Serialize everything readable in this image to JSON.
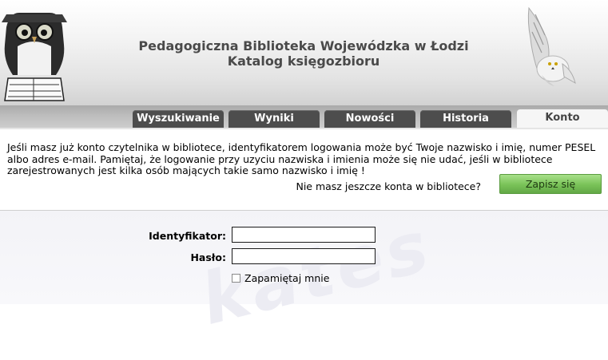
{
  "header": {
    "title_line1": "Pedagogiczna Biblioteka Wojewódzka w Łodzi",
    "title_line2": "Katalog księgozbioru"
  },
  "tabs": [
    {
      "label": "Wyszukiwanie",
      "active": false
    },
    {
      "label": "Wyniki",
      "active": false
    },
    {
      "label": "Nowości",
      "active": false
    },
    {
      "label": "Historia",
      "active": false
    },
    {
      "label": "Konto",
      "active": true
    }
  ],
  "info": {
    "text": "Jeśli masz już konto czytelnika w bibliotece, identyfikatorem logowania może być Twoje nazwisko i imię, numer PESEL albo adres e-mail. Pamiętaj, że logowanie przy uzyciu nazwiska i imienia może się nie udać, jeśli w bibliotece zarejestrowanych jest kilka osób mających takie samo nazwisko i imię !",
    "register_question": "Nie masz jeszcze konta w bibliotece?",
    "register_button": "Zapisz się"
  },
  "login": {
    "identifier_label": "Identyfikator:",
    "identifier_value": "",
    "password_label": "Hasło:",
    "password_value": "",
    "remember_label": "Zapamiętaj mnie",
    "remember_checked": false
  },
  "watermark": "kates",
  "colors": {
    "tab_bg": "#4d4d4d",
    "tab_active_bg": "#f6f6f6",
    "button_green": "#79c258"
  }
}
